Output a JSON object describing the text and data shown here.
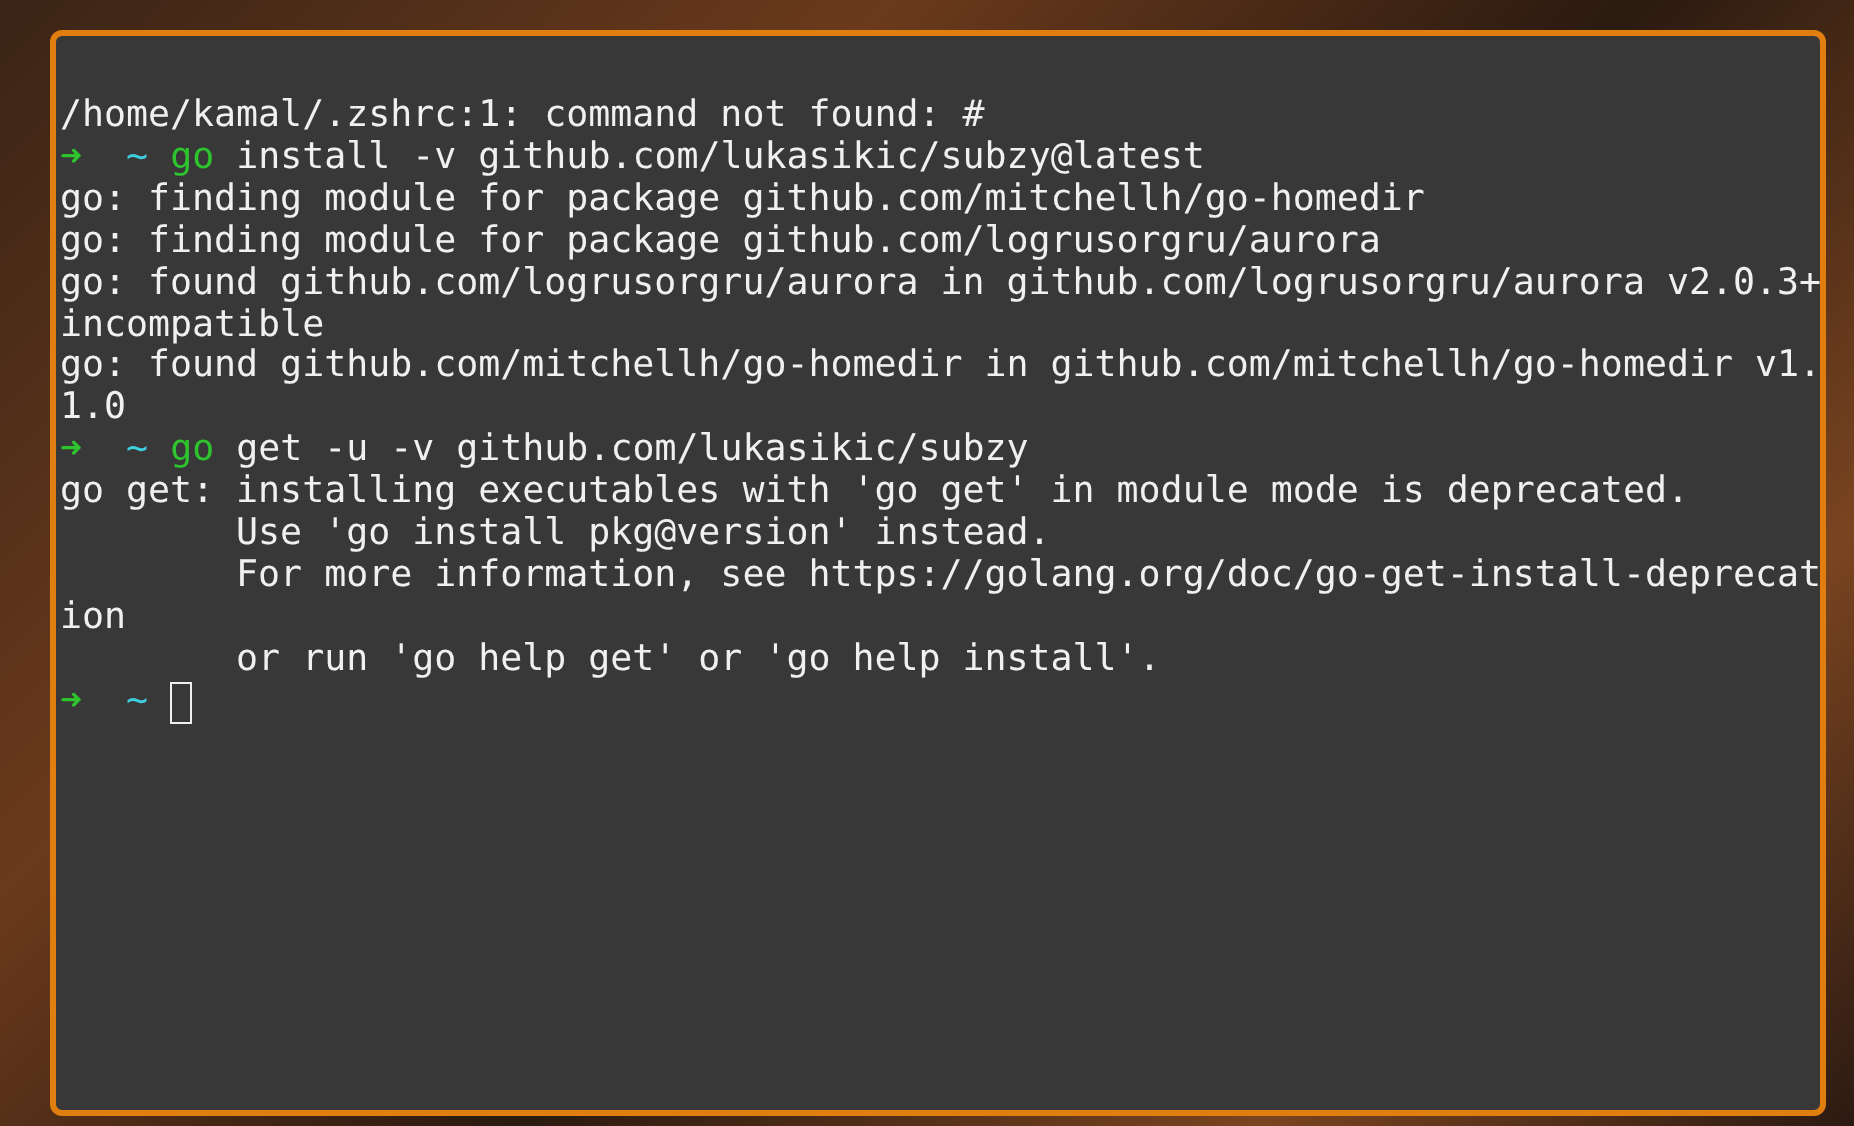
{
  "terminal": {
    "lines": [
      {
        "kind": "output",
        "text": "/home/kamal/.zshrc:1: command not found: #"
      },
      {
        "kind": "prompt",
        "arrow": "➜",
        "dir": "~",
        "command": "go",
        "args": "install -v github.com/lukasikic/subzy@latest"
      },
      {
        "kind": "output",
        "text": "go: finding module for package github.com/mitchellh/go-homedir"
      },
      {
        "kind": "output",
        "text": "go: finding module for package github.com/logrusorgru/aurora"
      },
      {
        "kind": "output",
        "text": "go: found github.com/logrusorgru/aurora in github.com/logrusorgru/aurora v2.0.3+"
      },
      {
        "kind": "output",
        "text": "incompatible"
      },
      {
        "kind": "output",
        "text": "go: found github.com/mitchellh/go-homedir in github.com/mitchellh/go-homedir v1."
      },
      {
        "kind": "output",
        "text": "1.0"
      },
      {
        "kind": "prompt",
        "arrow": "➜",
        "dir": "~",
        "command": "go",
        "args": "get -u -v github.com/lukasikic/subzy"
      },
      {
        "kind": "output",
        "text": "go get: installing executables with 'go get' in module mode is deprecated."
      },
      {
        "kind": "output",
        "text": "        Use 'go install pkg@version' instead."
      },
      {
        "kind": "output",
        "text": "        For more information, see https://golang.org/doc/go-get-install-deprecat"
      },
      {
        "kind": "output",
        "text": "ion"
      },
      {
        "kind": "output",
        "text": "        or run 'go help get' or 'go help install'."
      },
      {
        "kind": "cursor_prompt",
        "arrow": "➜",
        "dir": "~"
      }
    ]
  }
}
